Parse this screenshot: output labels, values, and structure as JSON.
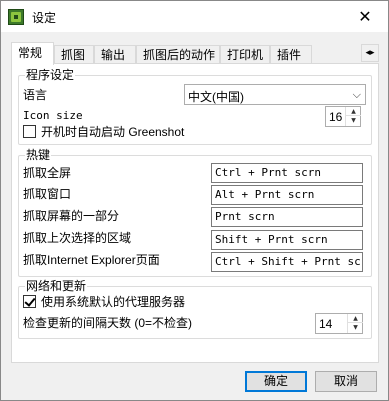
{
  "window": {
    "title": "设定",
    "close_glyph": "✕"
  },
  "tabs": [
    {
      "label": "常规"
    },
    {
      "label": "抓图"
    },
    {
      "label": "输出"
    },
    {
      "label": "抓图后的动作"
    },
    {
      "label": "打印机"
    },
    {
      "label": "插件"
    }
  ],
  "tab_scroll": {
    "left": "◂",
    "right": "▸"
  },
  "program_settings": {
    "title": "程序设定",
    "language_label": "语言",
    "language_value": "中文(中国)",
    "icon_size_label": "Icon size",
    "icon_size_value": "16",
    "autostart_label": "开机时自动启动 Greenshot",
    "autostart_checked": false
  },
  "hotkeys": {
    "title": "热键",
    "rows": [
      {
        "label": "抓取全屏",
        "value": "Ctrl + Prnt scrn"
      },
      {
        "label": "抓取窗口",
        "value": "Alt + Prnt scrn"
      },
      {
        "label": "抓取屏幕的一部分",
        "value": "Prnt scrn"
      },
      {
        "label": "抓取上次选择的区域",
        "value": "Shift + Prnt scrn"
      },
      {
        "label": "抓取Internet Explorer页面",
        "value": "Ctrl + Shift + Prnt scrn"
      }
    ]
  },
  "network": {
    "title": "网络和更新",
    "proxy_label": "使用系统默认的代理服务器",
    "proxy_checked": true,
    "update_label": "检查更新的间隔天数 (0=不检查)",
    "update_value": "14"
  },
  "buttons": {
    "ok": "确定",
    "cancel": "取消"
  },
  "icons": {
    "app": "greenshot-app-icon",
    "close": "close-icon",
    "dropdown": "chevron-down-icon",
    "spin_up": "spin-up-icon",
    "spin_down": "spin-down-icon"
  },
  "colors": {
    "accent": "#0078d7",
    "panel": "#ffffff",
    "background": "#f0f0f0"
  }
}
